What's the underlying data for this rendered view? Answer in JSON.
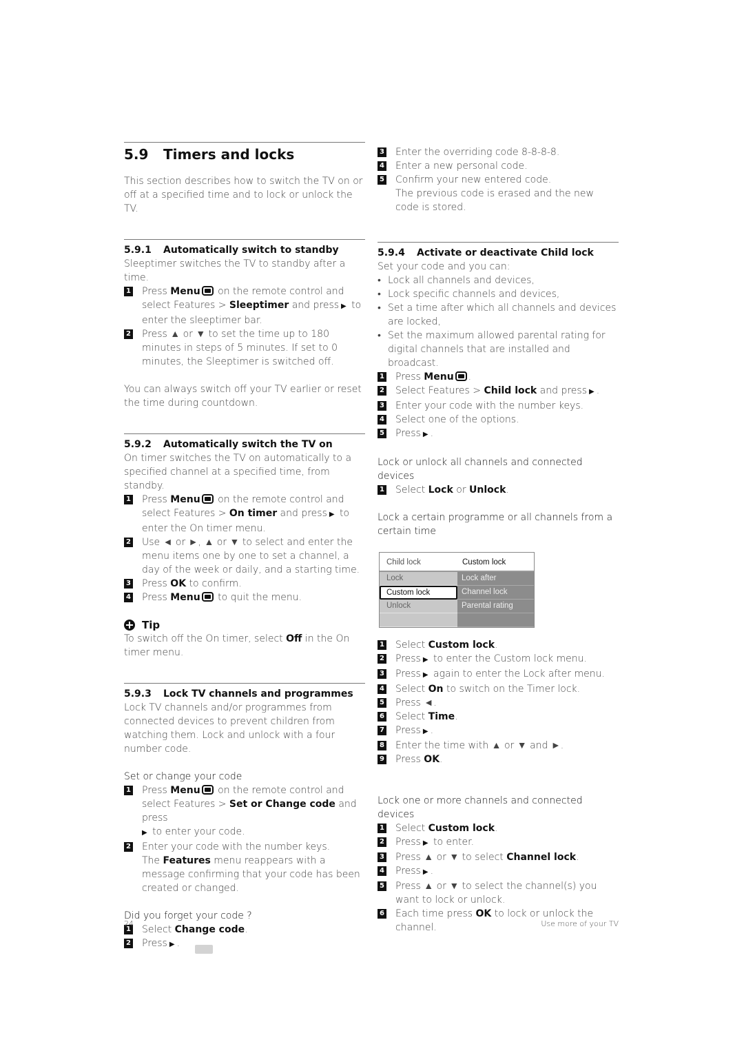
{
  "section": {
    "number": "5.9",
    "title": "Timers and locks",
    "intro": "This section describes how to switch the TV on or off at a specified time and to lock or unlock the TV."
  },
  "s591": {
    "number": "5.9.1",
    "title": "Automatically switch to standby",
    "intro": "Sleeptimer switches the TV to standby after a time.",
    "steps": [
      {
        "n": "1",
        "pre": "Press ",
        "b1": "Menu",
        "mid": " on the remote control and select Features > ",
        "b2": "Sleeptimer",
        "post": " and press",
        "end": " to enter the sleeptimer bar."
      },
      {
        "n": "2",
        "text": "Press ▲ or ▼ to set the time up to 180 minutes in steps of 5 minutes. If set to 0 minutes, the Sleeptimer is switched off."
      }
    ],
    "note": "You can always switch off your TV earlier or reset the time during countdown."
  },
  "s592": {
    "number": "5.9.2",
    "title": "Automatically switch the TV on",
    "intro": "On timer switches the TV on automatically to a specified channel at a specified time, from standby.",
    "steps": [
      {
        "n": "1",
        "pre": "Press ",
        "b1": "Menu",
        "mid": " on the remote control and select Features > ",
        "b2": "On timer",
        "post": " and press",
        "end": " to enter the On timer menu."
      },
      {
        "n": "2",
        "text": "Use ◄ or ►, ▲ or ▼ to select and enter the menu items one by one to set a channel, a day of the week or daily, and a starting time."
      },
      {
        "n": "3",
        "pre": "Press ",
        "b1": "OK",
        "post": " to confirm."
      },
      {
        "n": "4",
        "pre": "Press ",
        "b1": "Menu",
        "post": " to quit the menu."
      }
    ],
    "tip_title": "Tip",
    "tip_pre": "To switch off the On timer, select ",
    "tip_b": "Off",
    "tip_post": " in the On timer menu."
  },
  "s593": {
    "number": "5.9.3",
    "title": "Lock TV channels and programmes",
    "intro": "Lock TV channels and/or programmes from connected devices to prevent children from watching them. Lock and unlock with a four number code.",
    "set_code_title": "Set or change your code",
    "set_steps": [
      {
        "n": "1",
        "pre": "Press ",
        "b1": "Menu",
        "mid": " on the remote control and select Features > ",
        "b2": "Set or Change code",
        "post": " and press",
        "end": " to enter your code."
      },
      {
        "n": "2",
        "text": "Enter your code with the number keys.",
        "pre2": "The ",
        "b2": "Features",
        "post2": " menu reappears with a message confirming that your code has been created or changed."
      }
    ],
    "forgot_title": "Did you forget your code ?",
    "forgot_steps": [
      {
        "n": "1",
        "pre": "Select ",
        "b1": "Change code",
        "post": "."
      },
      {
        "n": "2",
        "pre": "Press",
        "post": "."
      },
      {
        "n": "3",
        "text": "Enter the overriding code 8-8-8-8."
      },
      {
        "n": "4",
        "text": "Enter a new personal code."
      },
      {
        "n": "5",
        "text": "Confirm your new entered code.",
        "extra": "The previous code is erased and the new code is stored."
      }
    ]
  },
  "s594": {
    "number": "5.9.4",
    "title": "Activate or deactivate Child lock",
    "intro": "Set your code and you can:",
    "bullets": [
      "Lock all channels and devices,",
      "Lock specific channels and devices,",
      "Set a time after which all channels and devices are locked,",
      "Set the maximum allowed parental rating for digital channels that are installed and broadcast."
    ],
    "steps": [
      {
        "n": "1",
        "pre": "Press ",
        "b1": "Menu",
        "post": "."
      },
      {
        "n": "2",
        "pre": "Select Features > ",
        "b1": "Child lock",
        "post": " and press",
        "end": "."
      },
      {
        "n": "3",
        "text": "Enter your code with the number keys."
      },
      {
        "n": "4",
        "text": "Select one of the options."
      },
      {
        "n": "5",
        "pre": "Press",
        "post": "."
      }
    ],
    "lockall_title": "Lock or unlock all channels and connected devices",
    "lockall_step": {
      "n": "1",
      "pre": "Select ",
      "b1": "Lock",
      "mid": " or ",
      "b2": "Unlock",
      "post": "."
    },
    "certain_title": "Lock a certain programme or all channels from a certain time",
    "menu": {
      "header_left": "Child lock",
      "header_right": "Custom lock",
      "left_items": [
        "Lock",
        "Custom lock",
        "Unlock",
        ""
      ],
      "right_items": [
        "Lock after",
        "Channel lock",
        "Parental rating",
        ""
      ],
      "selected": "Custom lock"
    },
    "certain_steps": [
      {
        "n": "1",
        "pre": "Select ",
        "b1": "Custom lock",
        "post": "."
      },
      {
        "n": "2",
        "pre": "Press",
        "post": " to enter the Custom lock menu."
      },
      {
        "n": "3",
        "pre": "Press",
        "post": " again to enter the Lock after menu."
      },
      {
        "n": "4",
        "pre": "Select ",
        "b1": "On",
        "post": " to switch on the Timer lock."
      },
      {
        "n": "5",
        "text": "Press ◄."
      },
      {
        "n": "6",
        "pre": "Select ",
        "b1": "Time",
        "post": "."
      },
      {
        "n": "7",
        "pre": "Press",
        "post": "."
      },
      {
        "n": "8",
        "text": "Enter the time with ▲ or ▼ and ►."
      },
      {
        "n": "9",
        "pre": "Press ",
        "b1": "OK",
        "post": "."
      }
    ],
    "more_title": "Lock one or more channels and connected devices",
    "more_steps": [
      {
        "n": "1",
        "pre": "Select ",
        "b1": "Custom lock",
        "post": "."
      },
      {
        "n": "2",
        "pre": "Press",
        "post": " to enter."
      },
      {
        "n": "3",
        "pre": "Press ▲ or ▼ to select ",
        "b1": "Channel lock",
        "post": "."
      },
      {
        "n": "4",
        "pre": "Press",
        "post": "."
      },
      {
        "n": "5",
        "text": "Press ▲ or ▼ to select the channel(s) you want to lock or unlock."
      },
      {
        "n": "6",
        "pre": "Each time press ",
        "b1": "OK",
        "post": " to lock or unlock the channel."
      }
    ]
  },
  "footer": {
    "page_number": "24",
    "chapter": "Use more of your TV"
  }
}
